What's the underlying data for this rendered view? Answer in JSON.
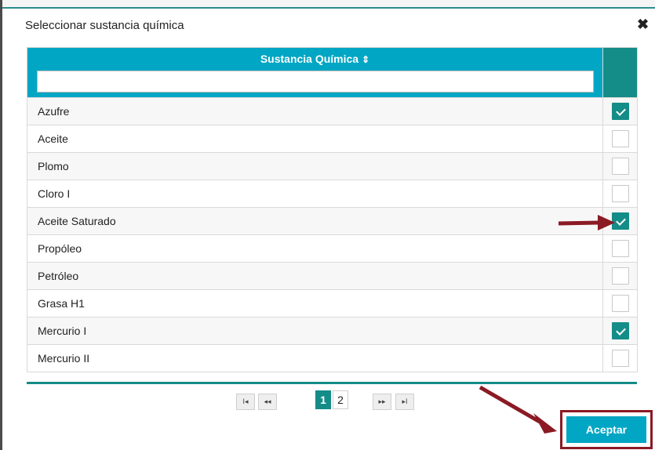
{
  "dialog": {
    "title": "Seleccionar sustancia química",
    "close_icon": "close-icon"
  },
  "table": {
    "column_header": "Sustancia Química",
    "sort_icon": "sort-icon",
    "filter_value": "",
    "rows": [
      {
        "name": "Azufre",
        "checked": true
      },
      {
        "name": "Aceite",
        "checked": false
      },
      {
        "name": "Plomo",
        "checked": false
      },
      {
        "name": "Cloro I",
        "checked": false
      },
      {
        "name": "Aceite Saturado",
        "checked": true
      },
      {
        "name": "Propóleo",
        "checked": false
      },
      {
        "name": "Petróleo",
        "checked": false
      },
      {
        "name": "Grasa H1",
        "checked": false
      },
      {
        "name": "Mercurio I",
        "checked": true
      },
      {
        "name": "Mercurio II",
        "checked": false
      }
    ]
  },
  "pagination": {
    "first": "I◂",
    "prev": "◂◂",
    "pages": [
      "1",
      "2"
    ],
    "current_page": "1",
    "next": "▸▸",
    "last": "▸I"
  },
  "accept_button": "Aceptar",
  "colors": {
    "header": "#00a6c4",
    "accent": "#148c87",
    "annotation_arrow": "#8b1a24"
  }
}
